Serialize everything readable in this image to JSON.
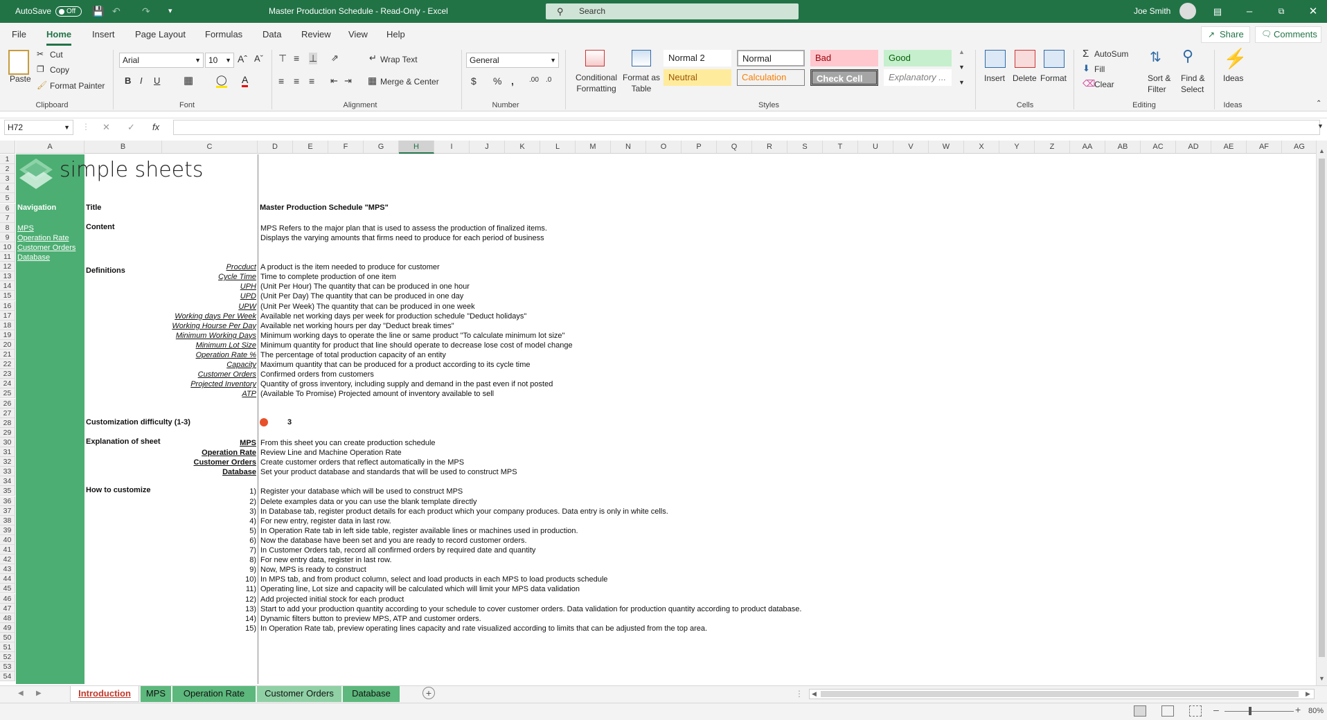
{
  "titlebar": {
    "autosave_label": "AutoSave",
    "autosave_state": "Off",
    "doc_title": "Master Production Schedule  -  Read-Only  -  Excel",
    "search_placeholder": "Search",
    "user_name": "Joe Smith"
  },
  "ribbon_tabs": [
    "File",
    "Home",
    "Insert",
    "Page Layout",
    "Formulas",
    "Data",
    "Review",
    "View",
    "Help"
  ],
  "share_label": "Share",
  "comments_label": "Comments",
  "ribbon": {
    "clipboard": {
      "paste": "Paste",
      "cut": "Cut",
      "copy": "Copy",
      "format_painter": "Format Painter",
      "group": "Clipboard"
    },
    "font": {
      "name": "Arial",
      "size": "10",
      "bold": "B",
      "italic": "I",
      "underline": "U",
      "group": "Font"
    },
    "alignment": {
      "wrap_text": "Wrap Text",
      "merge_center": "Merge & Center",
      "group": "Alignment"
    },
    "number": {
      "format": "General",
      "group": "Number"
    },
    "styles": {
      "conditional_formatting_1": "Conditional",
      "conditional_formatting_2": "Formatting",
      "format_as_table_1": "Format as",
      "format_as_table_2": "Table",
      "normal2": "Normal 2",
      "normal": "Normal",
      "bad": "Bad",
      "good": "Good",
      "neutral": "Neutral",
      "calculation": "Calculation",
      "check_cell": "Check Cell",
      "explanatory": "Explanatory ...",
      "group": "Styles"
    },
    "cells": {
      "insert": "Insert",
      "delete": "Delete",
      "format": "Format",
      "group": "Cells"
    },
    "editing": {
      "autosum": "AutoSum",
      "fill": "Fill",
      "clear": "Clear",
      "sort_filter_1": "Sort &",
      "sort_filter_2": "Filter",
      "find_select_1": "Find &",
      "find_select_2": "Select",
      "group": "Editing"
    },
    "ideas": {
      "label": "Ideas",
      "group": "Ideas"
    }
  },
  "formula_bar": {
    "name_box": "H72",
    "fx": "fx",
    "formula": ""
  },
  "columns": [
    "A",
    "B",
    "C",
    "D",
    "E",
    "F",
    "G",
    "H",
    "I",
    "J",
    "K",
    "L",
    "M",
    "N",
    "O",
    "P",
    "Q",
    "R",
    "S",
    "T",
    "U",
    "V",
    "W",
    "X",
    "Y",
    "Z",
    "AA",
    "AB",
    "AC",
    "AD",
    "AE",
    "AF",
    "AG"
  ],
  "selected_column": "H",
  "row_numbers": [
    "1",
    "2",
    "3",
    "4",
    "5",
    "6",
    "7",
    "8",
    "9",
    "10",
    "11",
    "12",
    "13",
    "14",
    "15",
    "16",
    "17",
    "18",
    "19",
    "20",
    "21",
    "22",
    "23",
    "24",
    "25",
    "26",
    "27",
    "28",
    "29",
    "30",
    "31",
    "32",
    "33",
    "34",
    "35",
    "36",
    "37",
    "38",
    "39",
    "40",
    "41",
    "42",
    "43",
    "44",
    "45",
    "46",
    "47",
    "48",
    "49",
    "50",
    "51",
    "52",
    "53",
    "54"
  ],
  "sheet": {
    "logo_text": "simple sheets",
    "navigation_label": "Navigation",
    "nav_links": [
      "MPS",
      "Operation Rate",
      "Customer Orders",
      "Database"
    ],
    "title_label": "Title",
    "title_value": "Master Production Schedule \"MPS\"",
    "content_label": "Content",
    "content_lines": [
      "MPS Refers to the major plan that is used to assess the production of finalized items.",
      "Displays the varying amounts that firms need to produce for each period of business"
    ],
    "definitions_label": "Definitions",
    "definitions": [
      {
        "term": "Procduct",
        "desc": "A product is the item needed to produce for customer"
      },
      {
        "term": "Cycle Time",
        "desc": "Time to complete production of one item"
      },
      {
        "term": "UPH",
        "desc": "(Unit Per Hour) The quantity that can be produced in one hour"
      },
      {
        "term": "UPD",
        "desc": "(Unit Per Day) The quantity that can be produced in one day"
      },
      {
        "term": "UPW",
        "desc": "(Unit Per Week) The quantity that can be produced in one week"
      },
      {
        "term": "Working days Per Week",
        "desc": "Available net working days per week for production schedule \"Deduct holidays\""
      },
      {
        "term": "Working Hourse Per Day",
        "desc": "Available net working hours per day \"Deduct break times\""
      },
      {
        "term": "Minimum Working Days",
        "desc": "Minimum working days to operate the line or same product \"To calculate minimum lot size\""
      },
      {
        "term": "Minimum Lot Size",
        "desc": "Minimum quantity for product that line should operate to decrease lose cost of model change"
      },
      {
        "term": "Operation Rate %",
        "desc": "The percentage of total production capacity of an entity"
      },
      {
        "term": "Capacity",
        "desc": "Maximum quantity that can be produced for a product according to its cycle time"
      },
      {
        "term": "Customer Orders",
        "desc": "Confirmed orders from customers"
      },
      {
        "term": "Projected Inventory",
        "desc": "Quantity of gross inventory, including supply and demand in the past even if not posted"
      },
      {
        "term": "ATP",
        "desc": "(Available To Promise) Projected amount of inventory available to sell"
      }
    ],
    "difficulty_label": "Customization difficulty (1-3)",
    "difficulty_value": "3",
    "difficulty_color": "#e8502a",
    "explanation_label": "Explanation of sheet",
    "explanations": [
      {
        "term": "MPS",
        "desc": "From this sheet you can create production schedule"
      },
      {
        "term": "Operation Rate",
        "desc": "Review Line and Machine Operation Rate"
      },
      {
        "term": "Customer Orders",
        "desc": "Create customer orders that reflect automatically in the MPS"
      },
      {
        "term": "Database",
        "desc": "Set your product database and standards that will be used to construct MPS"
      }
    ],
    "howto_label": "How to customize",
    "steps": [
      {
        "n": "1)",
        "text": "Register your database which will be used to construct MPS"
      },
      {
        "n": "2)",
        "text": "Delete examples data or you can use the blank template directly"
      },
      {
        "n": "3)",
        "text": "In Database tab, register product details for each product which your company produces. Data entry is only in white cells."
      },
      {
        "n": "4)",
        "text": "For new entry, register data in last row."
      },
      {
        "n": "5)",
        "text": "In Operation Rate tab in left side table, register available lines or machines used in production."
      },
      {
        "n": "6)",
        "text": "Now the database have been set and you are ready to record customer orders."
      },
      {
        "n": "7)",
        "text": "In Customer Orders tab, record all confirmed orders by required date and quantity"
      },
      {
        "n": "8)",
        "text": "For new entry data, register in last row."
      },
      {
        "n": "9)",
        "text": "Now, MPS is ready to construct"
      },
      {
        "n": "10)",
        "text": "In MPS tab, and from product column, select and load products in each MPS to load products schedule"
      },
      {
        "n": "11)",
        "text": "Operating line, Lot size and capacity will be calculated which will limit your MPS data validation"
      },
      {
        "n": "12)",
        "text": "Add projected initial stock for each product"
      },
      {
        "n": "13)",
        "text": "Start to add your production quantity according to your schedule to cover customer orders. Data validation for production quantity according to product database."
      },
      {
        "n": "14)",
        "text": "Dynamic filters button to preview MPS, ATP and customer orders."
      },
      {
        "n": "15)",
        "text": "In Operation Rate tab, preview operating lines capacity and rate visualized according to limits that can be adjusted from the top area."
      }
    ]
  },
  "sheet_tabs": [
    "Introduction",
    "MPS",
    "Operation Rate",
    "Customer Orders",
    "Database"
  ],
  "active_sheet_tab": "Introduction",
  "zoom": "80%",
  "colors": {
    "excel_green": "#217346",
    "nav_green": "#4cae72",
    "tab_green": "#5cb87c",
    "active_tab_text": "#c0392b"
  }
}
